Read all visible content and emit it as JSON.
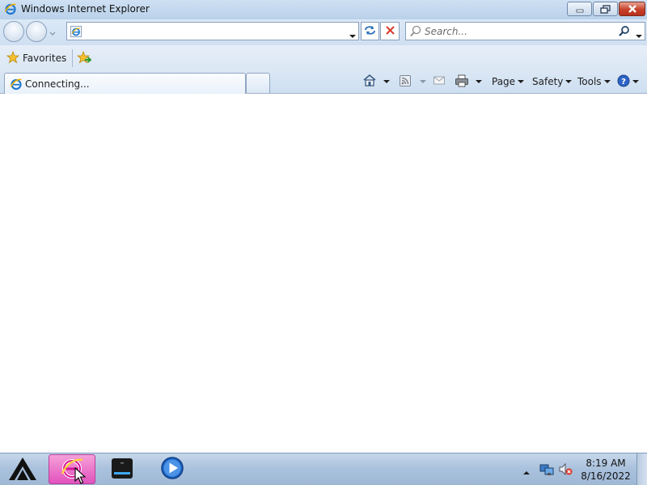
{
  "window": {
    "title": "Windows Internet Explorer"
  },
  "navbar": {
    "address_value": "",
    "search_placeholder": "Search..."
  },
  "favorites": {
    "label": "Favorites"
  },
  "tabs": [
    {
      "label": "Connecting..."
    }
  ],
  "commandbar": {
    "page_label": "Page",
    "safety_label": "Safety",
    "tools_label": "Tools"
  },
  "taskbar": {
    "clock_time": "8:19 AM",
    "clock_date": "8/16/2022"
  },
  "colors": {
    "close_button": "#c7412a",
    "active_task": "#e152bd",
    "ie_blue": "#1f78d1",
    "ie_gold": "#f2b200"
  },
  "icons": [
    "ie-icon",
    "minimize-icon",
    "maximize-icon",
    "close-icon",
    "back-arrow-icon",
    "forward-arrow-icon",
    "refresh-icon",
    "stop-icon",
    "search-icon",
    "favorites-star-icon",
    "add-favorite-icon",
    "home-icon",
    "feeds-icon",
    "mail-icon",
    "print-icon",
    "help-icon",
    "start-icon",
    "ie-taskbar-icon",
    "drive-icon",
    "media-player-icon",
    "network-icon",
    "volume-muted-icon",
    "mouse-cursor-icon"
  ]
}
